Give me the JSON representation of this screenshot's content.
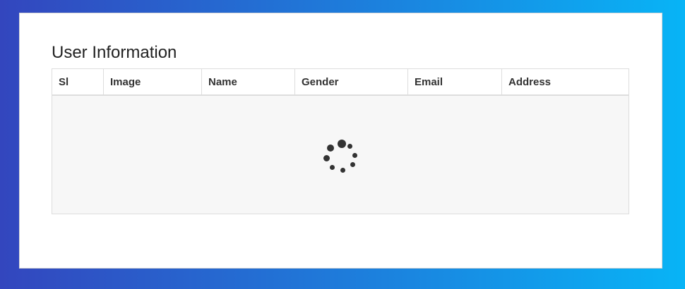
{
  "page": {
    "title": "User Information"
  },
  "table": {
    "columns": [
      "Sl",
      "Image",
      "Name",
      "Gender",
      "Email",
      "Address"
    ],
    "state": "loading"
  },
  "icons": {
    "loader": "loading-spinner-icon"
  },
  "colors": {
    "gradient_start": "#3346be",
    "gradient_end": "#08b4f6",
    "spinner": "#333333",
    "loading_background": "#f7f7f7"
  }
}
